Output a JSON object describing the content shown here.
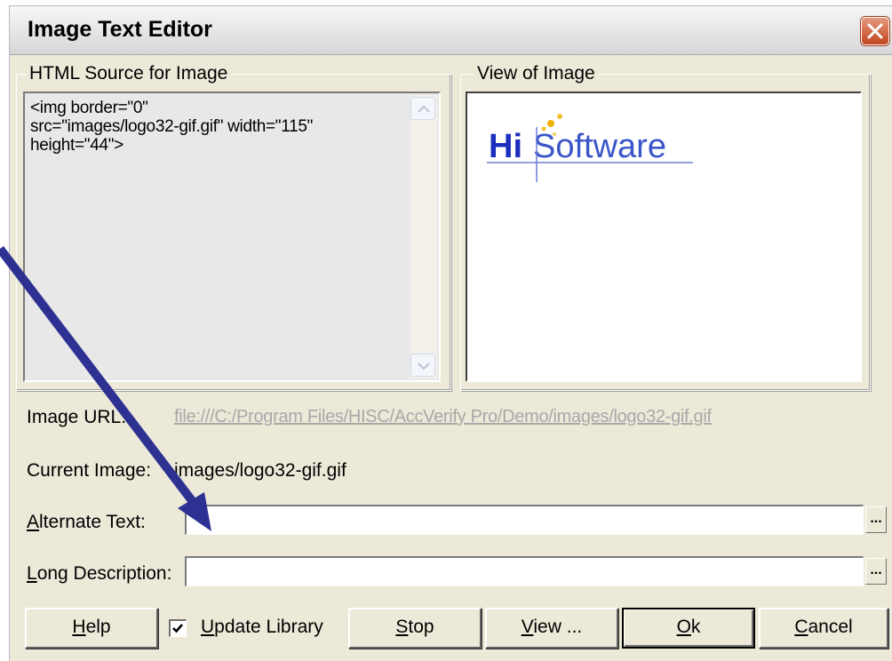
{
  "window": {
    "title": "Image Text Editor",
    "close_icon": "close-icon",
    "close_color": "#c84c22"
  },
  "source_group": {
    "legend": "HTML Source for Image",
    "text": "<img border=\"0\"\nsrc=\"images/logo32-gif.gif\" width=\"115\"\nheight=\"44\">"
  },
  "view_group": {
    "legend": "View of Image",
    "logo": {
      "part1": "Hi",
      "part2": "Software",
      "blue": "#1b2fbf",
      "dot_color": "#f0b000"
    }
  },
  "fields": {
    "image_url_label": "Image URL:",
    "image_url_value": "file:///C:/Program Files/HISC/AccVerify Pro/Demo/images/logo32-gif.gif",
    "current_image_label": "Current Image:",
    "current_image_value": "images/logo32-gif.gif",
    "alt_text_label_a": "A",
    "alt_text_label_rest": "lternate Text:",
    "alt_text_value": "",
    "long_desc_label_a": "L",
    "long_desc_label_rest": "ong Description:",
    "long_desc_value": "",
    "ellipsis": "..."
  },
  "buttons": {
    "help_u": "H",
    "help_rest": "elp",
    "update_library_u": "U",
    "update_library_rest": "pdate Library",
    "update_library_checked": true,
    "stop_u": "S",
    "stop_rest": "top",
    "view_u": "V",
    "view_rest": "iew ...",
    "ok_u": "O",
    "ok_rest": "k",
    "cancel_u": "C",
    "cancel_rest": "ancel"
  },
  "annotation": {
    "arrow_color": "#2e3192"
  }
}
